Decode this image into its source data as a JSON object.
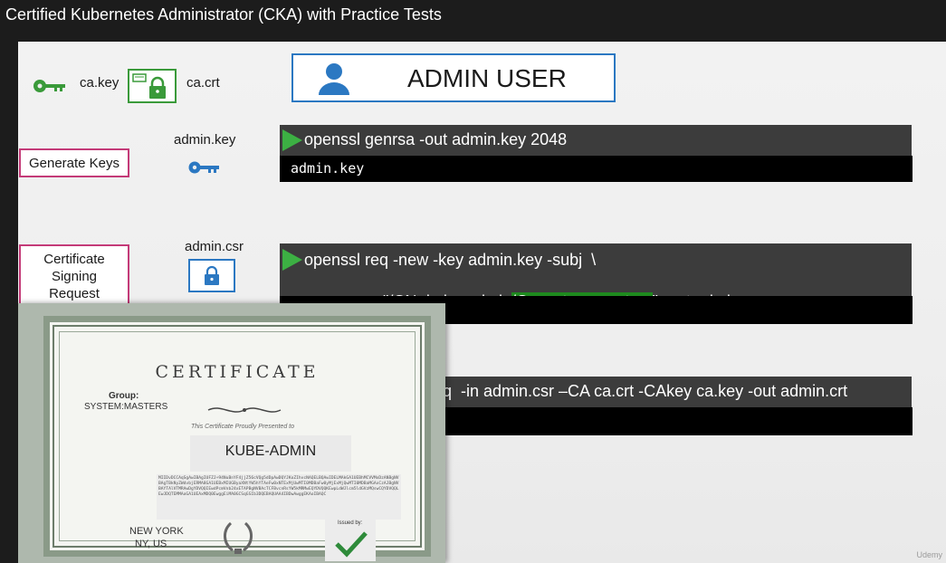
{
  "window": {
    "title": "Certified Kubernetes Administrator (CKA) with Practice Tests"
  },
  "ca": {
    "key_label": "ca.key",
    "crt_label": "ca.crt"
  },
  "admin_user": {
    "label": "ADMIN USER"
  },
  "steps": {
    "generate_keys": {
      "label": "Generate Keys",
      "file_label": "admin.key"
    },
    "csr": {
      "label_lines": [
        "Certificate",
        "Signing",
        "Request"
      ],
      "file_label": "admin.csr"
    }
  },
  "commands": {
    "genrsa": {
      "command": "openssl genrsa -out admin.key 2048",
      "output": "admin.key"
    },
    "req": {
      "line1": "openssl req -new -key admin.key -subj  \\",
      "line2_pre": "\"/CN=kube-admin",
      "line2_highlight": "/O=system:masters",
      "line2_post": "\" -out admin.csr",
      "output": ""
    },
    "x509": {
      "command_visible": "q  -in admin.csr –CA ca.crt -CAkey ca.key -out admin.crt",
      "output": ""
    }
  },
  "certificate": {
    "title": "CERTIFICATE",
    "group_label": "Group:",
    "group_value": "SYSTEM:MASTERS",
    "presented_text": "This Certificate Proudly Presented to",
    "name": "KUBE-ADMIN",
    "location_line1": "NEW YORK",
    "location_line2": "NY, US",
    "issued_by": "Issued by:",
    "body_text": "MIIDvDCCAqSgAwIBAgIUFZJ+94NuBnYF4jjZ56cVQg5dDpAwDQYJKoZIhvcNAQELBQAwIDELMAkGA1UEBhMCVVMxDzANBgNVBAgTBkNyZWdvbjERMA8GA1UEBxMIUGByaXNtYW5hYTAeFw0xNTExMjUwMTI0MDBaFw0yMjExMjQwMTI0MDBaMGAxCzAJBgNVBAYTAlVTMRAwDgYDVQQIEwdPcmVnb24xETAPBgNVBAcTCFBvcnRsYW5kMRMwEQYDVQQKEwpLdWJlcm5ldGVzMQswCQYDVQQLEwJDQTEMMAoGA1UEAxMDQ0EwggEiMA0GCSqGSIb3DQEBAQUAA4IBDwAwggEKAoIBAQC"
  },
  "watermark": "Udemy"
}
